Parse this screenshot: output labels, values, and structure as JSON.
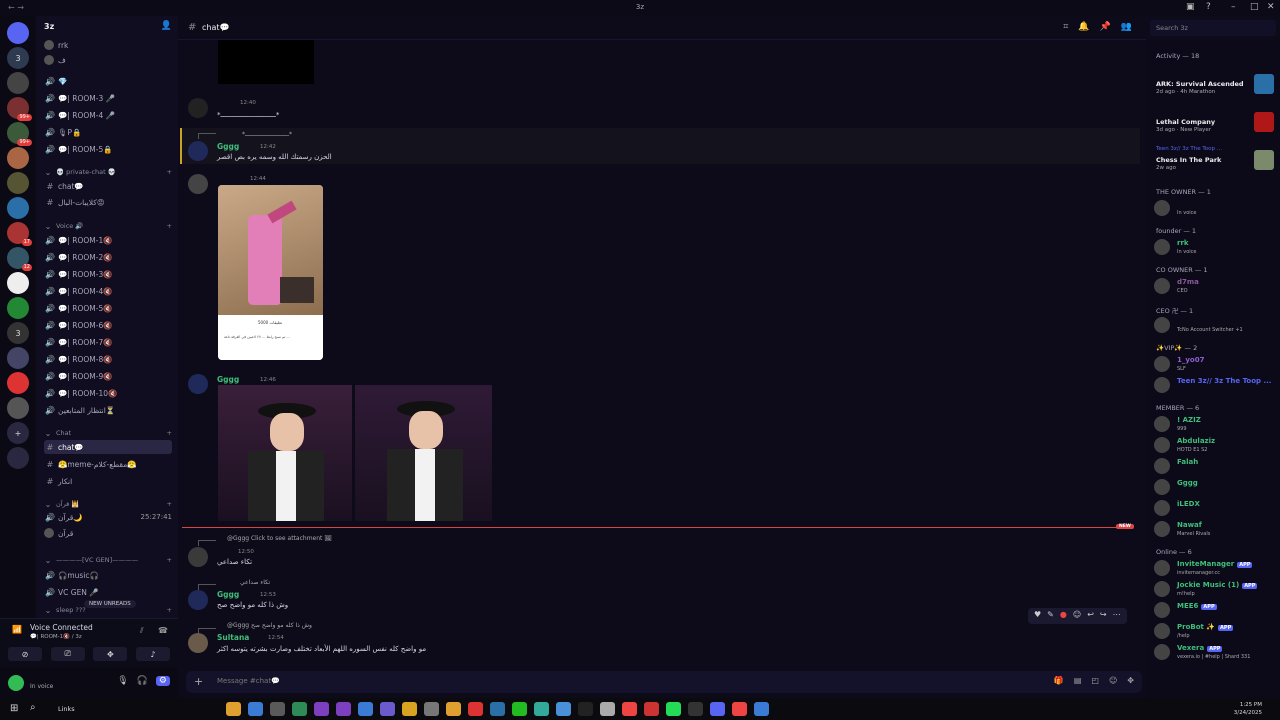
{
  "window": {
    "title": "3z",
    "search_placeholder": "Search 3z"
  },
  "colors": {
    "accent": "#5865f2",
    "unread_red": "#d94444",
    "member_green": "#3fbf7a",
    "app_bg": "#0d0b1a"
  },
  "rail": {
    "servers": [
      {
        "label": "",
        "badge": ""
      },
      {
        "label": "3",
        "badge": ""
      },
      {
        "label": "",
        "badge": ""
      },
      {
        "label": "",
        "badge": "99+"
      },
      {
        "label": "",
        "badge": "99+"
      },
      {
        "label": "",
        "badge": ""
      },
      {
        "label": "",
        "badge": ""
      },
      {
        "label": "",
        "badge": ""
      },
      {
        "label": "",
        "badge": "17"
      },
      {
        "label": "",
        "badge": "12"
      },
      {
        "label": "",
        "badge": ""
      },
      {
        "label": "",
        "badge": ""
      },
      {
        "label": "3",
        "badge": ""
      },
      {
        "label": "",
        "badge": ""
      },
      {
        "label": "",
        "badge": ""
      },
      {
        "label": "",
        "badge": ""
      },
      {
        "label": "+",
        "badge": ""
      },
      {
        "label": "",
        "badge": ""
      }
    ]
  },
  "sidebar": {
    "guild_name": "3z",
    "rows": [
      {
        "kind": "user",
        "label": "rrk"
      },
      {
        "kind": "user",
        "label": "ف"
      },
      {
        "kind": "voice",
        "label": "💎"
      },
      {
        "kind": "voice",
        "label": "💬| ROOM-3 🎤"
      },
      {
        "kind": "voice",
        "label": "💬| ROOM-4 🎤"
      },
      {
        "kind": "voice",
        "label": "🎙P🔒"
      },
      {
        "kind": "voice",
        "label": "💬| ROOM-5🔒"
      },
      {
        "kind": "cat",
        "label": "💀 private-chat 💀"
      },
      {
        "kind": "text",
        "label": "chat💬"
      },
      {
        "kind": "text",
        "label": "كلايبات-البال😡"
      },
      {
        "kind": "cat",
        "label": "Voice 🔊"
      },
      {
        "kind": "voice",
        "label": "💬| ROOM-1🔇"
      },
      {
        "kind": "voice",
        "label": "💬| ROOM-2🔇"
      },
      {
        "kind": "voice",
        "label": "💬| ROOM-3🔇"
      },
      {
        "kind": "voice",
        "label": "💬| ROOM-4🔇"
      },
      {
        "kind": "voice",
        "label": "💬| ROOM-5🔇"
      },
      {
        "kind": "voice",
        "label": "💬| ROOM-6🔇"
      },
      {
        "kind": "voice",
        "label": "💬| ROOM-7🔇"
      },
      {
        "kind": "voice",
        "label": "💬| ROOM-8🔇"
      },
      {
        "kind": "voice",
        "label": "💬| ROOM-9🔇"
      },
      {
        "kind": "voice",
        "label": "💬| ROOM-10🔇"
      },
      {
        "kind": "voice",
        "label": "انتظار المتابعين⏳"
      },
      {
        "kind": "cat",
        "label": "Chat"
      },
      {
        "kind": "text-active",
        "label": "chat💬"
      },
      {
        "kind": "text",
        "label": "😤meme-مقطع-كلام😤"
      },
      {
        "kind": "text",
        "label": "انكار"
      },
      {
        "kind": "cat",
        "label": "قرآن 🕌"
      },
      {
        "kind": "voice",
        "label": "قرآن🌙",
        "tail": "25:27:41"
      },
      {
        "kind": "user",
        "label": "قرآن"
      },
      {
        "kind": "cat",
        "label": "————[VC GEN]————"
      },
      {
        "kind": "voice",
        "label": "🎧music🎧"
      },
      {
        "kind": "voice",
        "label": "VC GEN 🎤"
      },
      {
        "kind": "cat",
        "label": "sleep ???"
      }
    ],
    "new_unreads": "NEW UNREADS"
  },
  "voice_panel": {
    "label": "Voice Connected",
    "channel": "💬| ROOM-1🔇 / 3z"
  },
  "user_panel": {
    "status": "In voice"
  },
  "chat": {
    "channel_name": "chat💬",
    "composer_placeholder": "Message #chat💬",
    "new_tag": "NEW",
    "messages": [
      {
        "id": "m1",
        "username": "",
        "time": "12:40",
        "text": "*ـــــــــــــــــــــــــــ*"
      },
      {
        "id": "m2",
        "reply_preview": "*ـــــــــــــــــــــــــ*",
        "username": "Gggg",
        "time": "12:42",
        "text": "الحزن رسمتك الله وسمه يره بص اقصر"
      },
      {
        "id": "m3",
        "username": "",
        "time": "12:44",
        "text": ""
      },
      {
        "id": "m4",
        "username": "Gggg",
        "time": "12:46",
        "text": ""
      },
      {
        "id": "m5",
        "reply_preview": "@Gggg Click to see attachment 🖼",
        "username": "",
        "time": "12:50",
        "text": "تكاء صداعي"
      },
      {
        "id": "m6",
        "reply_preview": "تكاء صداعي",
        "username": "Gggg",
        "time": "12:53",
        "text": "وش ذا كله مو واضح صح"
      },
      {
        "id": "m7",
        "reply_preview": "@Gggg وش ذا كله مو واضح صح",
        "username": "Sultana",
        "time": "12:54",
        "text": "مو واضح كله نفس السوره اللهم الأبعاد تختلف وصارت بشرته يتوسه اكثر"
      }
    ],
    "image_text": "تم نسخ رابط ... ٢٧ لاعبين في الغرفة تاعة ... ",
    "image_caption": "5000 تعليقات"
  },
  "members": {
    "activity_header": "Activity — 18",
    "activities": [
      {
        "title": "ARK: Survival Ascended",
        "sub": "2d ago · 4h Marathon",
        "color": "#2a6fa8"
      },
      {
        "title": "Lethal Company",
        "sub": "3d ago · New Player",
        "color": "#b01818"
      },
      {
        "title": "Chess In The Park",
        "sub": "2w ago",
        "pre": "Teen 3z// 3z The Toop ...",
        "color": "#7a8a6a"
      }
    ],
    "sections": [
      {
        "header": "THE OWNER — 1",
        "items": [
          {
            "name": "",
            "sub": "In voice",
            "color": "#3fbf7a"
          }
        ]
      },
      {
        "header": "founder — 1",
        "items": [
          {
            "name": "rrk",
            "sub": "In voice",
            "color": "#3fbf7a"
          }
        ]
      },
      {
        "header": "CO OWNER — 1",
        "items": [
          {
            "name": "d7ma",
            "sub": "CEO",
            "color": "#8a5a9a"
          }
        ]
      },
      {
        "header": "CEO 卍 — 1",
        "items": [
          {
            "name": "",
            "sub": "TcNo Account Switcher +1",
            "color": "#3fbf7a"
          }
        ]
      },
      {
        "header": "✨VIP✨ — 2",
        "items": [
          {
            "name": "1_yo07",
            "sub": "SLF",
            "color": "#8f5fd0"
          },
          {
            "name": "Teen 3z// 3z The Toop ...",
            "sub": "",
            "color": "#5865f2"
          }
        ]
      },
      {
        "header": "MEMBER — 6",
        "items": [
          {
            "name": "! AZIZ",
            "sub": "999",
            "color": "#3fbf7a"
          },
          {
            "name": "Abdulaziz",
            "sub": "HOTD E1 S2",
            "color": "#3fbf7a"
          },
          {
            "name": "Falah",
            "sub": "",
            "color": "#3fbf7a"
          },
          {
            "name": "Gggg",
            "sub": "",
            "color": "#3fbf7a"
          },
          {
            "name": "iLEDX",
            "sub": "",
            "color": "#3fbf7a"
          },
          {
            "name": "Nawaf",
            "sub": "Marvel Rivals",
            "color": "#3fbf7a"
          }
        ]
      },
      {
        "header": "Online — 6",
        "items": [
          {
            "name": "InviteManager",
            "sub": "invitemanager.cc",
            "color": "#3fbf7a",
            "app": "APP"
          },
          {
            "name": "Jockie Music (1)",
            "sub": "m!help",
            "color": "#3fbf7a",
            "app": "APP"
          },
          {
            "name": "MEE6",
            "sub": "",
            "color": "#3fbf7a",
            "app": "APP"
          },
          {
            "name": "ProBot ✨",
            "sub": "/help",
            "color": "#3fbf7a",
            "app": "APP"
          },
          {
            "name": "Vexera",
            "sub": "vexera.io | #help | Shard 331",
            "color": "#3fbf7a",
            "app": "APP"
          }
        ]
      }
    ]
  },
  "taskbar": {
    "links_label": "Links",
    "time": "1:25 PM",
    "date": "3/24/2025"
  }
}
